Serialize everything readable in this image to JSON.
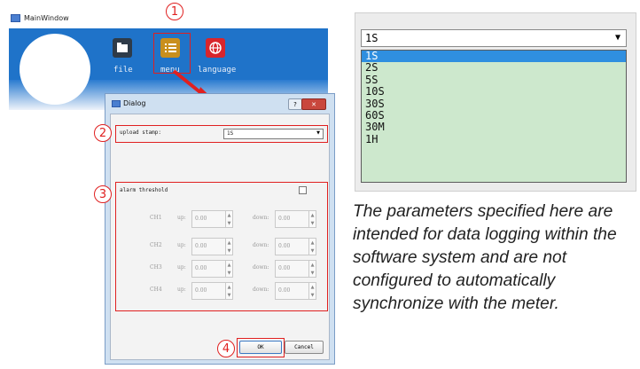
{
  "main_window": {
    "title": "MainWindow",
    "toolbar": [
      {
        "label": "file",
        "icon": "folder-icon"
      },
      {
        "label": "menu",
        "icon": "list-icon"
      },
      {
        "label": "language",
        "icon": "globe-icon"
      }
    ]
  },
  "dialog": {
    "title": "Dialog",
    "help": "?",
    "close": "✕",
    "upload_stamp": {
      "label": "upload stamp:",
      "value": "1S"
    },
    "alarm": {
      "label": "alarm threshold"
    },
    "channels": [
      {
        "name": "CH1",
        "up_label": "up:",
        "up": "0.00",
        "down_label": "down:",
        "down": "0.00"
      },
      {
        "name": "CH2",
        "up_label": "up:",
        "up": "0.00",
        "down_label": "down:",
        "down": "0.00"
      },
      {
        "name": "CH3",
        "up_label": "up:",
        "up": "0.00",
        "down_label": "down:",
        "down": "0.00"
      },
      {
        "name": "CH4",
        "up_label": "up:",
        "up": "0.00",
        "down_label": "down:",
        "down": "0.00"
      }
    ],
    "ok": "OK",
    "cancel": "Cancel"
  },
  "steps": [
    "1",
    "2",
    "3",
    "4"
  ],
  "dropdown": {
    "selected": "1S",
    "options": [
      "1S",
      "2S",
      "5S",
      "10S",
      "30S",
      "60S",
      "30M",
      "1H"
    ]
  },
  "note": "The parameters specified here are intended for data logging within the software system and are not configured to automatically synchronize with the meter.",
  "colors": {
    "highlight": "#e02020",
    "list_bg": "#cde8cd",
    "selected": "#2f8fe0",
    "app_blue": "#1f73c9"
  }
}
